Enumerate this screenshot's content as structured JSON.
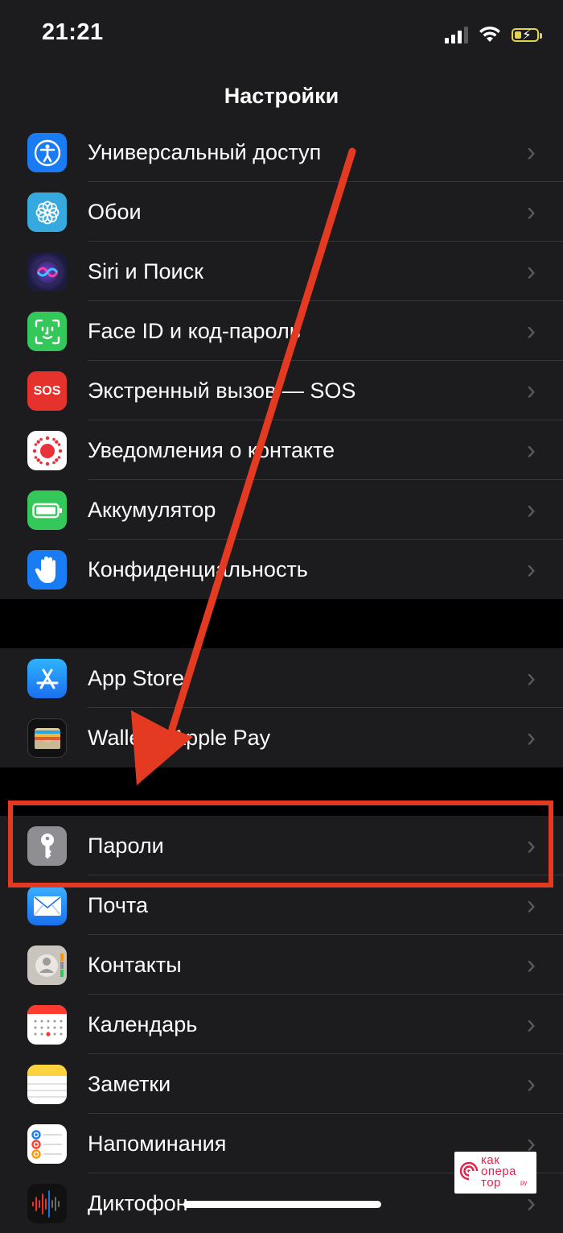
{
  "status_bar": {
    "time": "21:21"
  },
  "nav": {
    "title": "Настройки"
  },
  "groups": [
    [
      {
        "label": "Универсальный доступ",
        "icon": "accessibility-icon",
        "color": "#1a7cf5"
      },
      {
        "label": "Обои",
        "icon": "wallpaper-flower-icon",
        "color": "#36aadf"
      },
      {
        "label": "Siri и Поиск",
        "icon": "siri-icon",
        "color": "#1b1b3a"
      },
      {
        "label": "Face ID и код-пароль",
        "icon": "face-id-icon",
        "color": "#34c759"
      },
      {
        "label": "Экстренный вызов — SOS",
        "icon": "sos-icon",
        "color": "#e5322d",
        "icon_text": "SOS"
      },
      {
        "label": "Уведомления о контакте",
        "icon": "exposure-notification-icon",
        "color": "#ffffff"
      },
      {
        "label": "Аккумулятор",
        "icon": "battery-icon",
        "color": "#34c759"
      },
      {
        "label": "Конфиденциальность",
        "icon": "privacy-hand-icon",
        "color": "#1a7cf5"
      }
    ],
    [
      {
        "label": "App Store",
        "icon": "app-store-icon",
        "color": "#1a8cf5"
      },
      {
        "label": "Wallet и Apple Pay",
        "icon": "wallet-icon",
        "color": "#1c1c1e"
      }
    ],
    [
      {
        "label": "Пароли",
        "icon": "key-icon",
        "color": "#8e8e93"
      },
      {
        "label": "Почта",
        "icon": "mail-icon",
        "color": "#1a8cf5"
      },
      {
        "label": "Контакты",
        "icon": "contacts-icon",
        "color": "#c9c4bd"
      },
      {
        "label": "Календарь",
        "icon": "calendar-icon",
        "color": "#ffffff"
      },
      {
        "label": "Заметки",
        "icon": "notes-icon",
        "color": "#ffffff"
      },
      {
        "label": "Напоминания",
        "icon": "reminders-icon",
        "color": "#ffffff"
      },
      {
        "label": "Диктофон",
        "icon": "voice-memos-icon",
        "color": "#1c1c1e"
      }
    ]
  ],
  "watermark": {
    "line1": "как",
    "line2": "опера",
    "line3": "тор",
    "suffix": "ру"
  },
  "colors": {
    "annotation": "#e53a22",
    "background": "#000000",
    "cell": "#1c1c1e"
  }
}
